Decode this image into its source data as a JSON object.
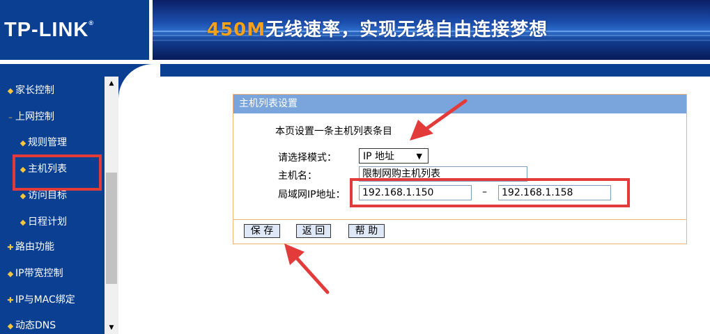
{
  "header": {
    "logo_text": "TP-LINK",
    "logo_reg": "®",
    "banner_speed": "450M",
    "banner_slogan": "无线速率，实现无线自由连接梦想"
  },
  "sidebar": {
    "items": [
      {
        "label": "家长控制",
        "bullet": "◆"
      },
      {
        "label": "上网控制",
        "bullet": "–"
      },
      {
        "label": "规则管理",
        "bullet": "◆"
      },
      {
        "label": "主机列表",
        "bullet": "◆"
      },
      {
        "label": "访问目标",
        "bullet": "◆"
      },
      {
        "label": "日程计划",
        "bullet": "◆"
      },
      {
        "label": "路由功能",
        "bullet": "✚"
      },
      {
        "label": "IP带宽控制",
        "bullet": "◆"
      },
      {
        "label": "IP与MAC绑定",
        "bullet": "✚"
      },
      {
        "label": "动态DNS",
        "bullet": "◆"
      }
    ],
    "scroll_up_icon": "▲",
    "scroll_down_icon": "▼"
  },
  "panel": {
    "title": "主机列表设置",
    "description": "本页设置一条主机列表条目",
    "mode_label": "请选择模式：",
    "mode_value": "IP 地址",
    "mode_arrow": "▼",
    "hostname_label": "主机名：",
    "hostname_value": "限制网购主机列表",
    "lan_ip_label": "局域网IP地址：",
    "ip_start": "192.168.1.150",
    "ip_dash": "–",
    "ip_end": "192.168.1.158",
    "buttons": {
      "save": "保 存",
      "back": "返 回",
      "help": "帮 助"
    }
  },
  "colors": {
    "sidebar_bg": "#0a3f91",
    "panel_title_bg": "#7aa5dc",
    "panel_border": "#f0b675",
    "annotation_red": "#e33a3a",
    "banner_accent": "#f5a21a"
  }
}
